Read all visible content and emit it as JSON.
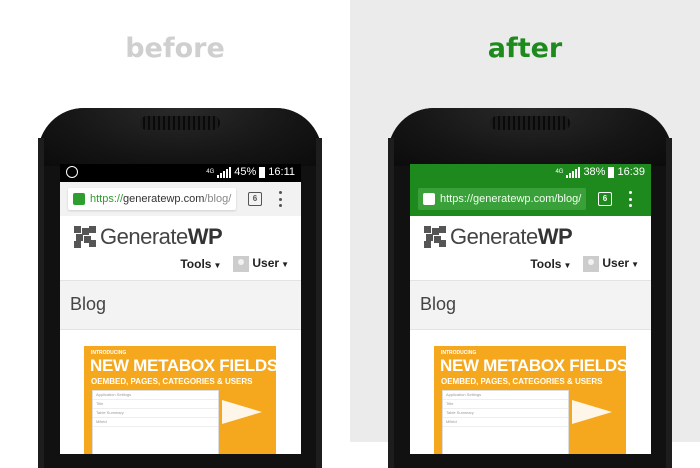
{
  "left": {
    "heading": "before",
    "status": {
      "battery": "45%",
      "time": "16:11",
      "network": "4G"
    },
    "address": {
      "https": "https://",
      "host": "generatewp.com",
      "path": "/blog/"
    },
    "tab_count": "6",
    "colors": {
      "status_bar": "#000000",
      "address_bar": "#f2f2f2"
    }
  },
  "right": {
    "heading": "after",
    "status": {
      "battery": "38%",
      "time": "16:39",
      "network": "4G"
    },
    "address": {
      "https": "https://",
      "host": "generatewp.com",
      "path": "/blog/"
    },
    "tab_count": "6",
    "colors": {
      "status_bar": "#1e8a1e",
      "address_bar": "#1e8a1e"
    }
  },
  "site": {
    "logo_plain": "Generate",
    "logo_bold": "WP",
    "nav_tools": "Tools",
    "nav_user": "User",
    "page_title": "Blog"
  },
  "banner": {
    "intro": "INTRODUCING",
    "title": "NEW METABOX FIELDS",
    "subtitle": "OEMBED, PAGES, CATEGORIES & USERS",
    "form_rows": [
      "Application Settings",
      "Title",
      "Table Summary",
      "Mfield"
    ]
  }
}
